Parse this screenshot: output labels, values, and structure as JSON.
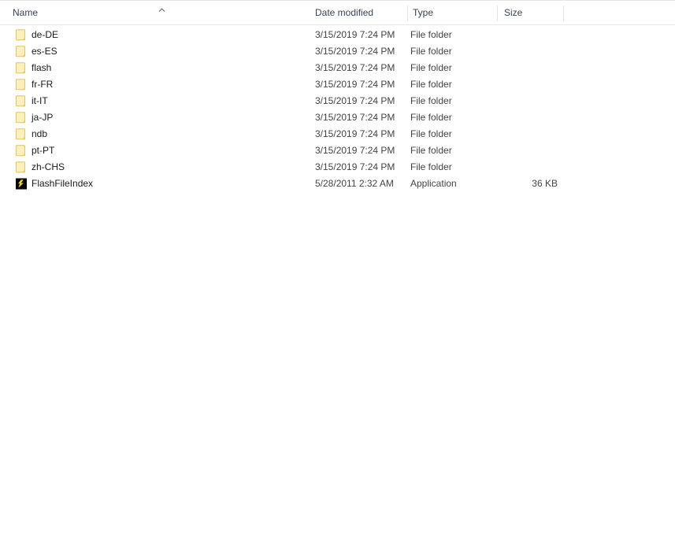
{
  "columns": [
    {
      "key": "name",
      "label": "Name",
      "sorted": true,
      "sort_direction": "ascending"
    },
    {
      "key": "date_modified",
      "label": "Date modified"
    },
    {
      "key": "type",
      "label": "Type"
    },
    {
      "key": "size",
      "label": "Size"
    }
  ],
  "header": {
    "name_label": "Name",
    "date_label": "Date modified",
    "type_label": "Type",
    "size_label": "Size",
    "sort_icon": "chevron-up-icon"
  },
  "colors": {
    "folder_fill": "#fce497",
    "folder_fill_light": "#fdf0bf",
    "folder_border": "#e3c65f",
    "app_icon_background": "#000000",
    "app_icon_bolt": "#ffdd00",
    "header_text": "#3c4253",
    "row_text": "#1a1a1a",
    "secondary_text": "#444444",
    "divider": "#e3e3e3",
    "background": "#ffffff"
  },
  "items": [
    {
      "name": "de-DE",
      "date_modified": "3/15/2019 7:24 PM",
      "type": "File folder",
      "size": "",
      "icon": "folder-icon"
    },
    {
      "name": "es-ES",
      "date_modified": "3/15/2019 7:24 PM",
      "type": "File folder",
      "size": "",
      "icon": "folder-icon"
    },
    {
      "name": "flash",
      "date_modified": "3/15/2019 7:24 PM",
      "type": "File folder",
      "size": "",
      "icon": "folder-icon"
    },
    {
      "name": "fr-FR",
      "date_modified": "3/15/2019 7:24 PM",
      "type": "File folder",
      "size": "",
      "icon": "folder-icon"
    },
    {
      "name": "it-IT",
      "date_modified": "3/15/2019 7:24 PM",
      "type": "File folder",
      "size": "",
      "icon": "folder-icon"
    },
    {
      "name": "ja-JP",
      "date_modified": "3/15/2019 7:24 PM",
      "type": "File folder",
      "size": "",
      "icon": "folder-icon"
    },
    {
      "name": "ndb",
      "date_modified": "3/15/2019 7:24 PM",
      "type": "File folder",
      "size": "",
      "icon": "folder-icon"
    },
    {
      "name": "pt-PT",
      "date_modified": "3/15/2019 7:24 PM",
      "type": "File folder",
      "size": "",
      "icon": "folder-icon"
    },
    {
      "name": "zh-CHS",
      "date_modified": "3/15/2019 7:24 PM",
      "type": "File folder",
      "size": "",
      "icon": "folder-icon"
    },
    {
      "name": "FlashFileIndex",
      "date_modified": "5/28/2011 2:32 AM",
      "type": "Application",
      "size": "36 KB",
      "icon": "flash-application-icon"
    }
  ],
  "item_count": 10
}
